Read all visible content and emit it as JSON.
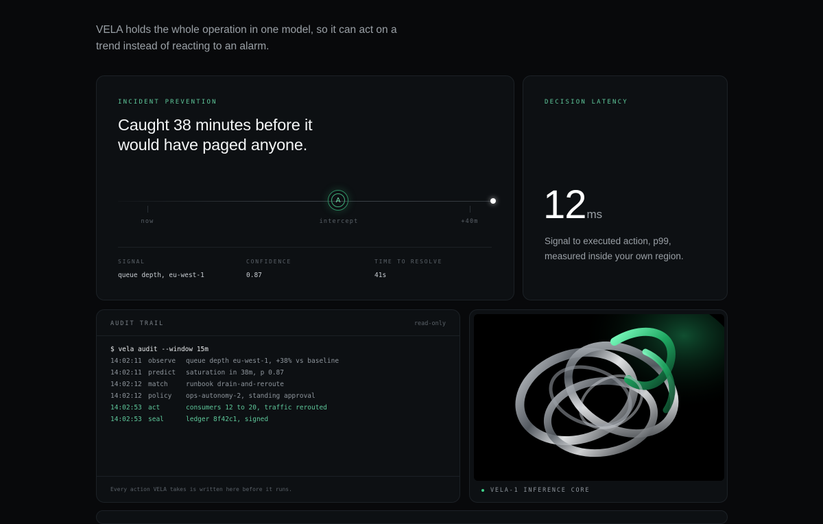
{
  "intro": "VELA holds the whole operation in one model, so it can act on a trend instead of reacting to an alarm.",
  "incident": {
    "eyebrow": "INCIDENT PREVENTION",
    "headline": "Caught 38 minutes before it would have paged anyone.",
    "timeline": {
      "now": "now",
      "intercept": "intercept",
      "end": "+40m",
      "marker_glyph": "A"
    },
    "stats": [
      {
        "label": "SIGNAL",
        "value": "queue depth, eu-west-1"
      },
      {
        "label": "CONFIDENCE",
        "value": "0.87"
      },
      {
        "label": "TIME TO RESOLVE",
        "value": "41s"
      }
    ]
  },
  "latency": {
    "eyebrow": "DECISION LATENCY",
    "value": "12",
    "unit": "ms",
    "description": "Signal to executed action, p99, measured inside your own region."
  },
  "audit": {
    "title": "AUDIT TRAIL",
    "mode": "read-only",
    "command": "$ vela audit --window 15m",
    "rows": [
      {
        "time": "14:02:11",
        "kind": "observe",
        "text": "queue depth eu-west-1, +38% vs baseline"
      },
      {
        "time": "14:02:11",
        "kind": "predict",
        "text": "saturation in 38m, p 0.87"
      },
      {
        "time": "14:02:12",
        "kind": "match",
        "text": "runbook drain-and-reroute"
      },
      {
        "time": "14:02:12",
        "kind": "policy",
        "text": "ops-autonomy-2, standing approval"
      },
      {
        "time": "14:02:53",
        "kind": "act",
        "text": "consumers 12 to 20, traffic rerouted"
      },
      {
        "time": "14:02:53",
        "kind": "seal",
        "text": "ledger 8f42c1, signed"
      }
    ],
    "footer": "Every action VELA takes is written here before it runs."
  },
  "core": {
    "label": "VELA-1 INFERENCE CORE"
  },
  "colors": {
    "accent": "#5ec79a",
    "background": "#08090b",
    "card": "#0d1013"
  }
}
